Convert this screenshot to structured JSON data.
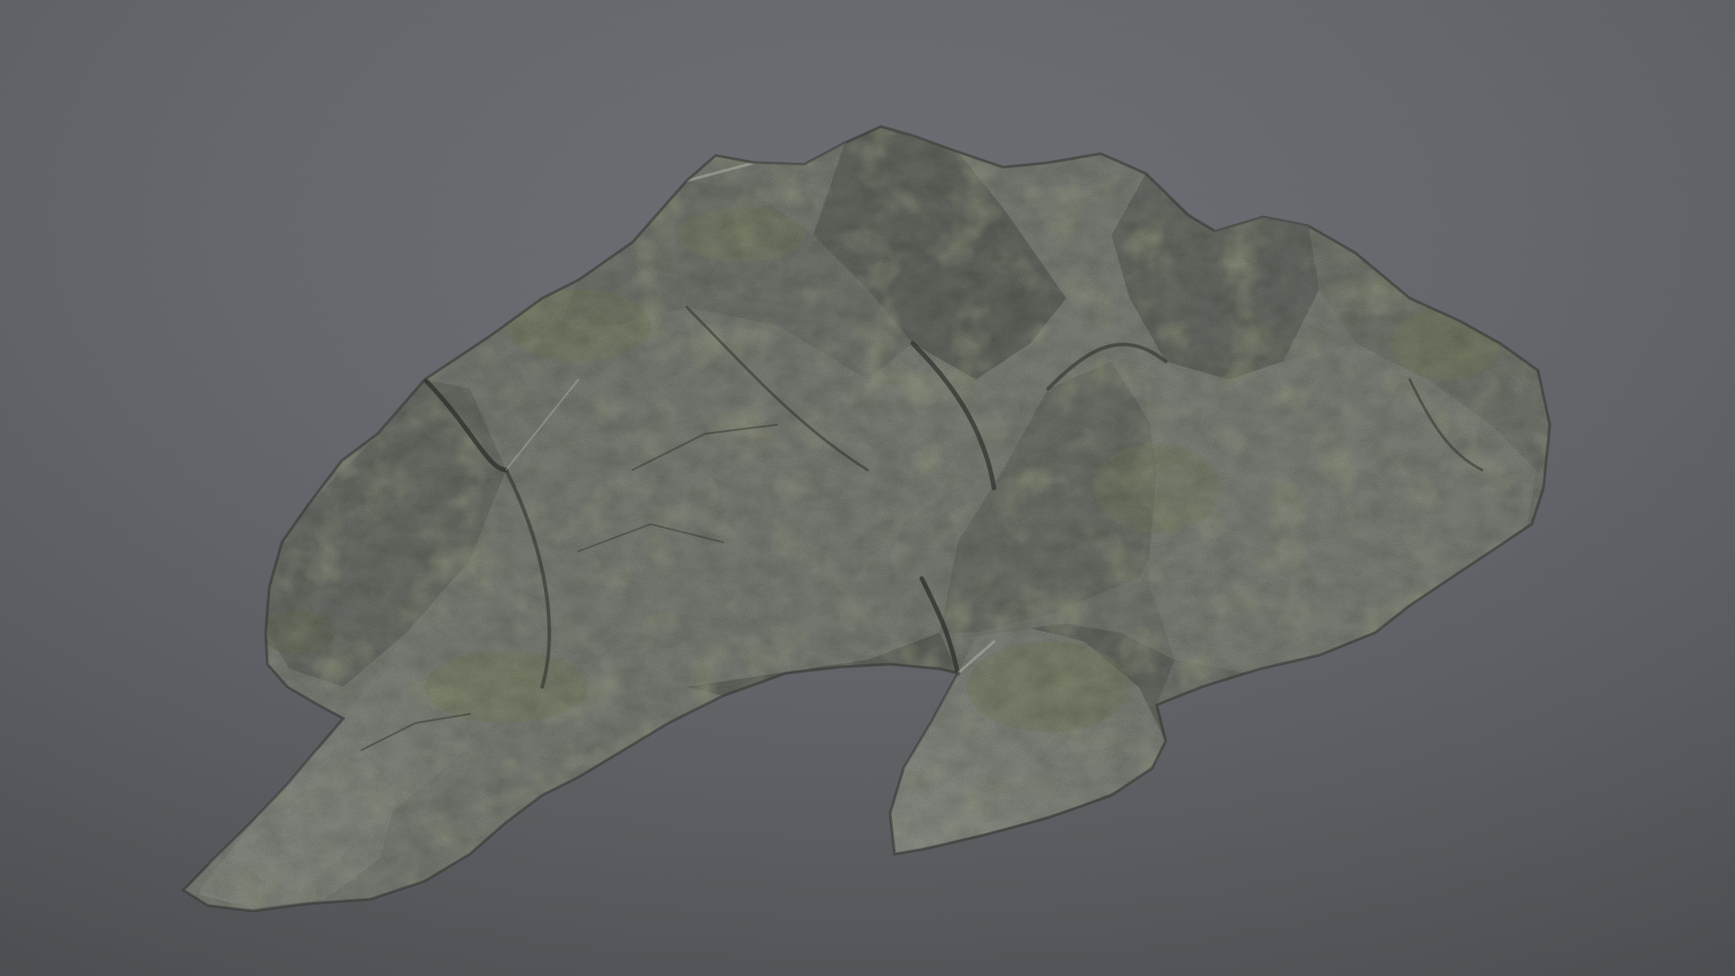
{
  "scene": {
    "subject": "mossy-rock-3d-model",
    "colors": {
      "background_top": "#676b70",
      "background_bottom": "#55585c",
      "rock_dark": "#2f3530",
      "rock_mid": "#5a5f58",
      "rock_light": "#8a8e86",
      "rock_highlight": "#a7aba2",
      "moss": "#6f7a3c",
      "moss_dark": "#4c5530"
    }
  }
}
